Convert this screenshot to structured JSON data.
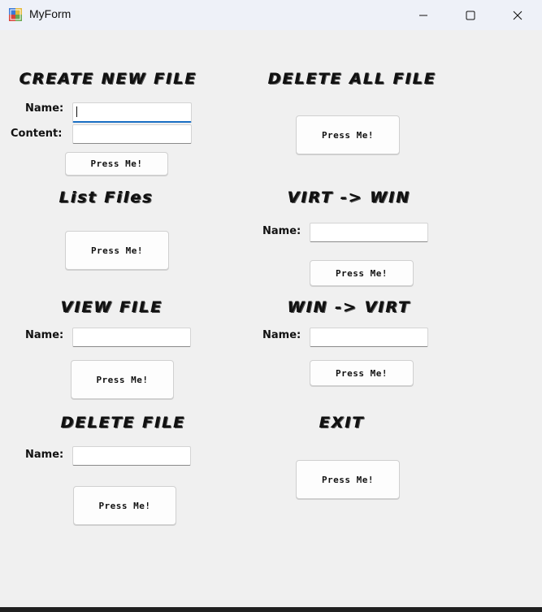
{
  "window": {
    "title": "MyForm"
  },
  "sections": {
    "create": {
      "heading": "CREATE NEW FILE",
      "name_label": "Name:",
      "content_label": "Content:",
      "button": "Press Me!"
    },
    "delete_all": {
      "heading": "DELETE ALL FILE",
      "button": "Press Me!"
    },
    "list": {
      "heading": "List Files",
      "button": "Press Me!"
    },
    "virt_to_win": {
      "heading": "VIRT -> WIN",
      "name_label": "Name:",
      "button": "Press Me!"
    },
    "view": {
      "heading": "VIEW FILE",
      "name_label": "Name:",
      "button": "Press Me!"
    },
    "win_to_virt": {
      "heading": "WIN -> VIRT",
      "name_label": "Name:",
      "button": "Press Me!"
    },
    "delete": {
      "heading": "DELETE FILE",
      "name_label": "Name:",
      "button": "Press Me!"
    },
    "exit": {
      "heading": "EXIT",
      "button": "Press Me!"
    }
  },
  "icons": {
    "app": "app-icon",
    "minimize": "minimize-icon",
    "maximize": "maximize-icon",
    "close": "close-icon"
  }
}
